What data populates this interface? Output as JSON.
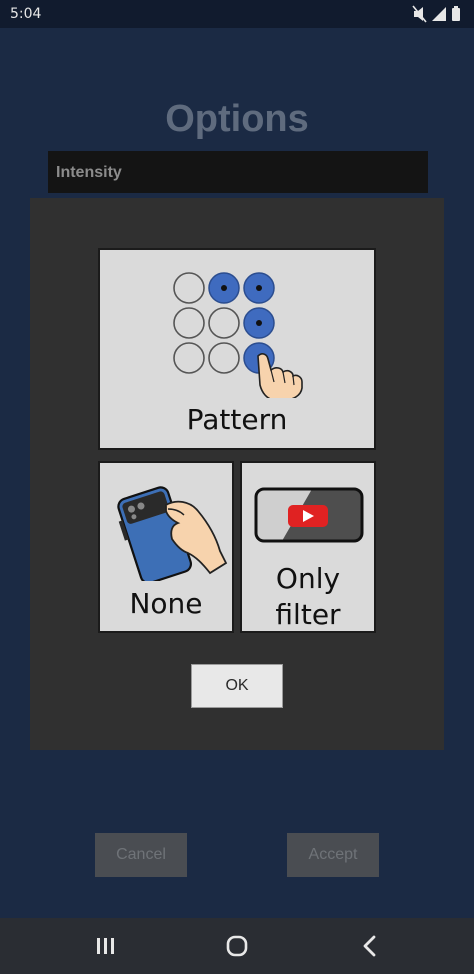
{
  "status_bar": {
    "time": "5:04",
    "icons": [
      "mute-icon",
      "signal-icon",
      "battery-icon"
    ]
  },
  "background_screen": {
    "title": "Options",
    "intensity_label": "Intensity",
    "cancel_label": "Cancel",
    "accept_label": "Accept"
  },
  "dialog": {
    "options": {
      "pattern": {
        "label": "Pattern",
        "icon": "pattern-lock-icon"
      },
      "none": {
        "label": "None",
        "icon": "phone-hand-icon"
      },
      "only_filter": {
        "label_line1": "Only",
        "label_line2": "filter",
        "icon": "video-filter-icon"
      }
    },
    "ok_label": "OK"
  },
  "nav_bar": {
    "buttons": [
      "recents-icon",
      "home-icon",
      "back-icon"
    ]
  },
  "colors": {
    "background": "#1b2a44",
    "dialog": "#303030",
    "option_tile": "#dadada",
    "accent_blue": "#3f6bbf",
    "youtube_red": "#e02222"
  }
}
